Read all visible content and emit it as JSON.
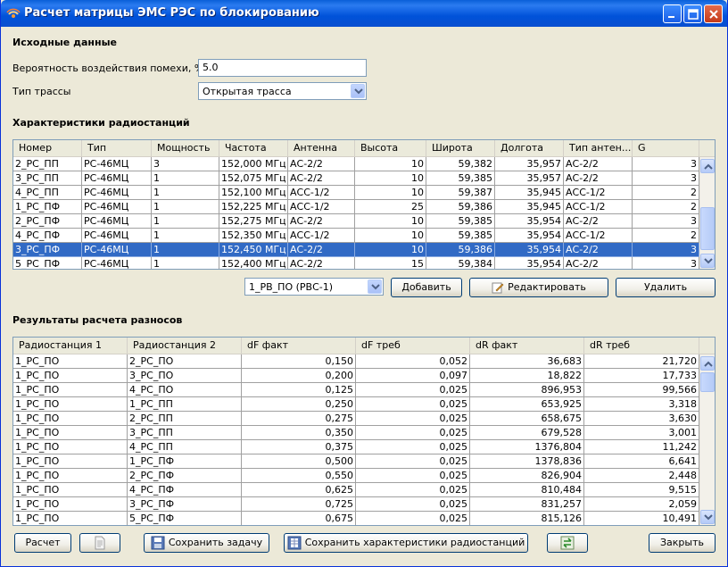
{
  "window": {
    "title": "Расчет матрицы ЭМС РЭС по блокированию"
  },
  "input_section": {
    "heading": "Исходные данные",
    "probability_label": "Вероятность воздействия помехи, %",
    "probability_value": "5.0",
    "route_label": "Тип трассы",
    "route_value": "Открытая трасса"
  },
  "stations": {
    "heading": "Характеристики радиостанций",
    "columns": [
      "Номер",
      "Тип",
      "Мощность",
      "Частота",
      "Антенна",
      "Высота",
      "Широта",
      "Долгота",
      "Тип антен...",
      "G"
    ],
    "rows": [
      [
        "2_РС_ПП",
        "РС-46МЦ",
        "3",
        "152,000 МГц",
        "АС-2/2",
        "10",
        "59,382",
        "35,957",
        "АС-2/2",
        "3"
      ],
      [
        "3_РС_ПП",
        "РС-46МЦ",
        "1",
        "152,075 МГц",
        "АС-2/2",
        "10",
        "59,385",
        "35,957",
        "АС-2/2",
        "3"
      ],
      [
        "4_РС_ПП",
        "РС-46МЦ",
        "1",
        "152,100 МГц",
        "АСС-1/2",
        "10",
        "59,387",
        "35,945",
        "АСС-1/2",
        "2"
      ],
      [
        "1_РС_ПФ",
        "РС-46МЦ",
        "1",
        "152,225 МГц",
        "АСС-1/2",
        "25",
        "59,386",
        "35,945",
        "АСС-1/2",
        "2"
      ],
      [
        "2_РС_ПФ",
        "РС-46МЦ",
        "1",
        "152,275 МГц",
        "АС-2/2",
        "10",
        "59,385",
        "35,954",
        "АС-2/2",
        "3"
      ],
      [
        "4_РС_ПФ",
        "РС-46МЦ",
        "1",
        "152,350 МГц",
        "АСС-1/2",
        "10",
        "59,385",
        "35,954",
        "АСС-1/2",
        "2"
      ],
      [
        "3_РС_ПФ",
        "РС-46МЦ",
        "1",
        "152,450 МГц",
        "АС-2/2",
        "10",
        "59,386",
        "35,954",
        "АС-2/2",
        "3"
      ],
      [
        "5_РС_ПФ",
        "РС-46МЦ",
        "1",
        "152,400 МГц",
        "АС-2/2",
        "15",
        "59,384",
        "35,954",
        "АС-2/2",
        "3"
      ]
    ],
    "selected_row": 6,
    "controls": {
      "type_select": "1_РВ_ПО (РВС-1)",
      "add": "Добавить",
      "edit": "Редактировать",
      "delete": "Удалить"
    }
  },
  "results": {
    "heading": "Результаты расчета разносов",
    "columns": [
      "Радиостанция 1",
      "Радиостанция 2",
      "dF факт",
      "dF треб",
      "dR факт",
      "dR треб"
    ],
    "rows": [
      [
        "1_РС_ПО",
        "2_РС_ПО",
        "0,150",
        "0,052",
        "36,683",
        "21,720"
      ],
      [
        "1_РС_ПО",
        "3_РС_ПО",
        "0,200",
        "0,097",
        "18,822",
        "17,733"
      ],
      [
        "1_РС_ПО",
        "4_РС_ПО",
        "0,125",
        "0,025",
        "896,953",
        "99,566"
      ],
      [
        "1_РС_ПО",
        "1_РС_ПП",
        "0,250",
        "0,025",
        "653,925",
        "3,318"
      ],
      [
        "1_РС_ПО",
        "2_РС_ПП",
        "0,275",
        "0,025",
        "658,675",
        "3,630"
      ],
      [
        "1_РС_ПО",
        "3_РС_ПП",
        "0,350",
        "0,025",
        "679,528",
        "3,001"
      ],
      [
        "1_РС_ПО",
        "4_РС_ПП",
        "0,375",
        "0,025",
        "1376,804",
        "11,242"
      ],
      [
        "1_РС_ПО",
        "1_РС_ПФ",
        "0,500",
        "0,025",
        "1378,836",
        "6,641"
      ],
      [
        "1_РС_ПО",
        "2_РС_ПФ",
        "0,550",
        "0,025",
        "826,904",
        "2,448"
      ],
      [
        "1_РС_ПО",
        "4_РС_ПФ",
        "0,625",
        "0,025",
        "810,484",
        "9,515"
      ],
      [
        "1_РС_ПО",
        "3_РС_ПФ",
        "0,725",
        "0,025",
        "831,257",
        "2,059"
      ],
      [
        "1_РС_ПО",
        "5_РС_ПФ",
        "0,675",
        "0,025",
        "815,126",
        "10,491"
      ]
    ]
  },
  "bottom_bar": {
    "calculate": "Расчет",
    "save_task": "Сохранить задачу",
    "save_stations": "Сохранить характеристики радиостанций",
    "close": "Закрыть"
  },
  "colors": {
    "accent": "#316ac5",
    "titlebar": "#0052d9",
    "window_bg": "#ece9d8"
  }
}
